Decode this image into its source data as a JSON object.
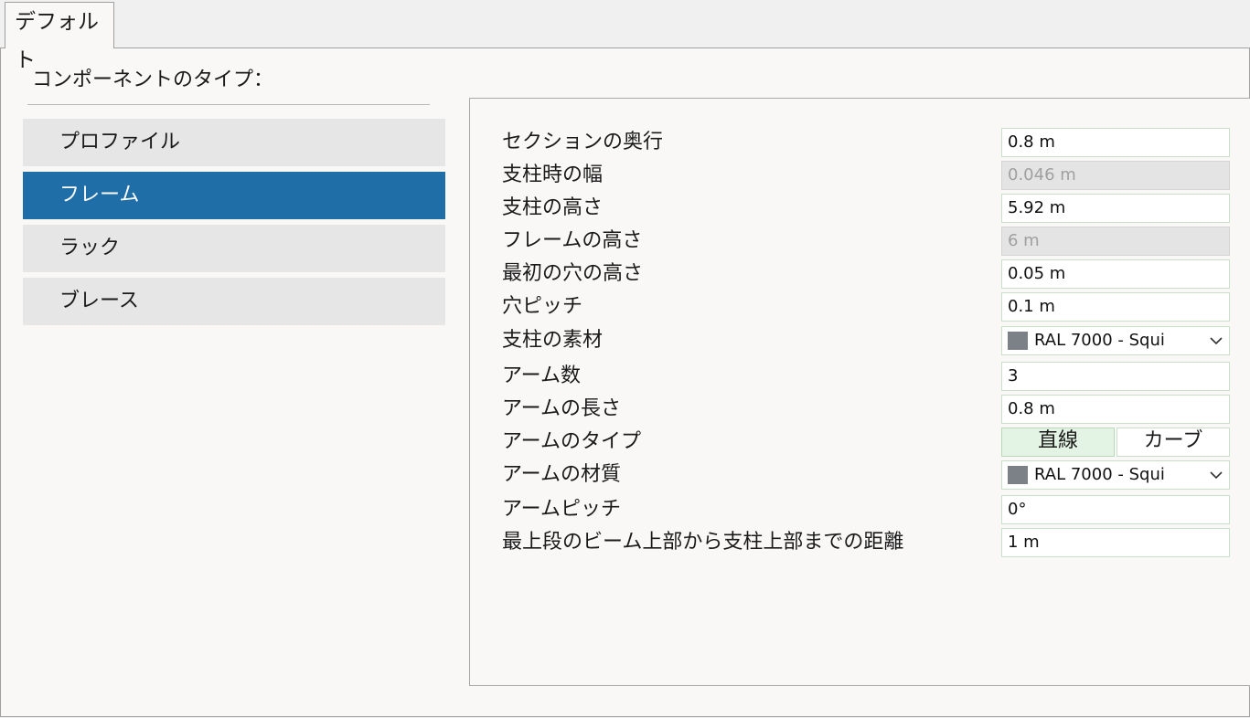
{
  "tab": {
    "label": "デフォルト"
  },
  "component_type_label": "コンポーネントのタイプ：",
  "nav": [
    {
      "label": "プロファイル",
      "selected": false
    },
    {
      "label": "フレーム",
      "selected": true
    },
    {
      "label": "ラック",
      "selected": false
    },
    {
      "label": "ブレース",
      "selected": false
    }
  ],
  "properties": {
    "section_depth": {
      "label": "セクションの奥行",
      "value": "0.8 m"
    },
    "post_width": {
      "label": "支柱時の幅",
      "value": "0.046 m",
      "disabled": true
    },
    "post_height": {
      "label": "支柱の高さ",
      "value": "5.92 m"
    },
    "frame_height": {
      "label": "フレームの高さ",
      "value": "6 m",
      "disabled": true
    },
    "first_hole_height": {
      "label": "最初の穴の高さ",
      "value": "0.05 m"
    },
    "hole_pitch": {
      "label": "穴ピッチ",
      "value": "0.1 m"
    },
    "post_material": {
      "label": "支柱の素材",
      "value": "RAL 7000 - Squi",
      "swatch_color": "#7b8186"
    },
    "arm_count": {
      "label": "アーム数",
      "value": "3"
    },
    "arm_length": {
      "label": "アームの長さ",
      "value": "0.8 m"
    },
    "arm_type": {
      "label": "アームのタイプ",
      "options": [
        "直線",
        "カーブ"
      ],
      "selected": "直線"
    },
    "arm_material": {
      "label": "アームの材質",
      "value": "RAL 7000 - Squi",
      "swatch_color": "#7b8186"
    },
    "arm_pitch": {
      "label": "アームピッチ",
      "value": "0°"
    },
    "top_beam_distance": {
      "label": "最上段のビーム上部から支柱上部までの距離",
      "value": "1 m"
    }
  },
  "colors": {
    "selected_nav": "#1f6ea8",
    "field_border": "#c8e0c8"
  }
}
